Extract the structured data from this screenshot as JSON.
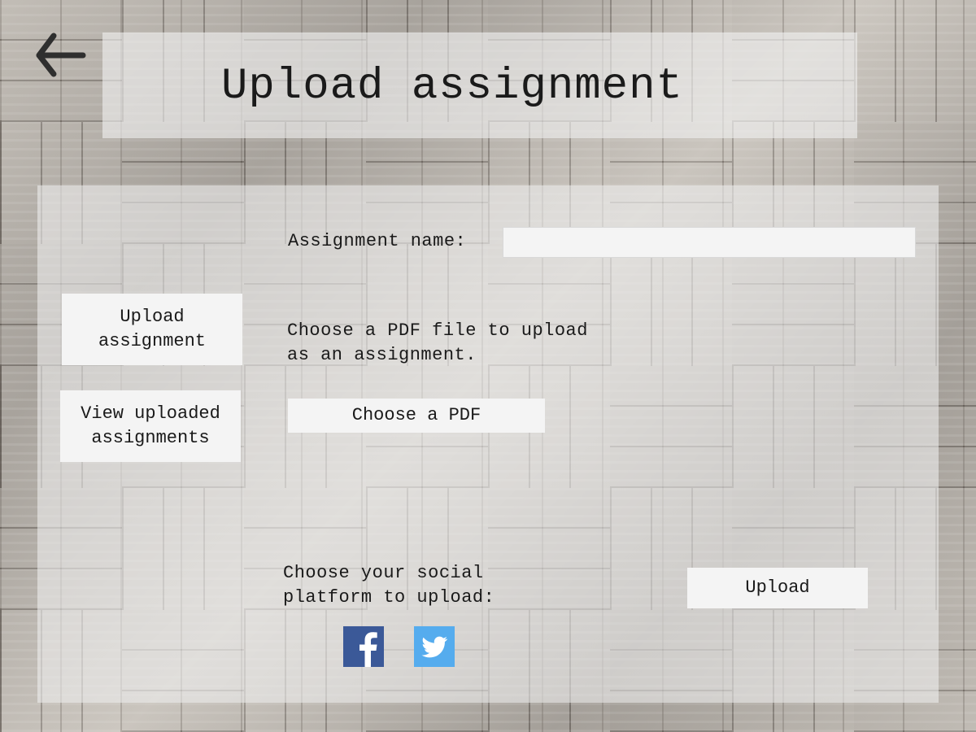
{
  "header": {
    "title": "Upload assignment",
    "back_icon": "back-arrow-icon"
  },
  "sidebar": {
    "items": [
      {
        "label": "Upload\nassignment"
      },
      {
        "label": "View uploaded\nassignments"
      }
    ]
  },
  "form": {
    "assignment_name_label": "Assignment name:",
    "assignment_name_value": "",
    "pdf_description": "Choose a PDF file to upload\nas an assignment.",
    "choose_pdf_label": "Choose a PDF",
    "social_label": "Choose your social\nplatform to upload:",
    "upload_label": "Upload",
    "social_platforms": [
      {
        "icon": "facebook-icon",
        "color": "#3b5998"
      },
      {
        "icon": "twitter-icon",
        "color": "#55acee"
      }
    ]
  }
}
